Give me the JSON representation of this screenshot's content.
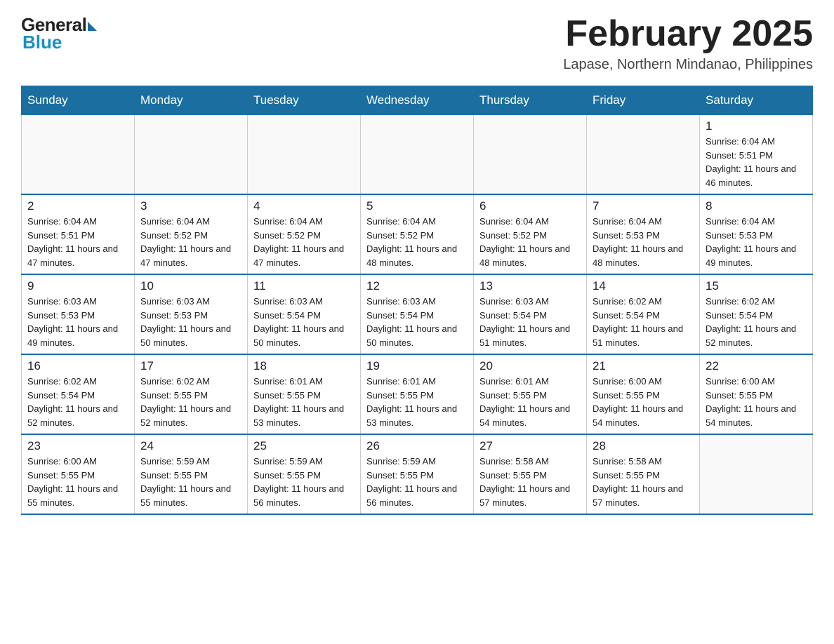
{
  "header": {
    "logo_general": "General",
    "logo_blue": "Blue",
    "month_title": "February 2025",
    "location": "Lapase, Northern Mindanao, Philippines"
  },
  "weekdays": [
    "Sunday",
    "Monday",
    "Tuesday",
    "Wednesday",
    "Thursday",
    "Friday",
    "Saturday"
  ],
  "weeks": [
    [
      {
        "day": "",
        "info": ""
      },
      {
        "day": "",
        "info": ""
      },
      {
        "day": "",
        "info": ""
      },
      {
        "day": "",
        "info": ""
      },
      {
        "day": "",
        "info": ""
      },
      {
        "day": "",
        "info": ""
      },
      {
        "day": "1",
        "info": "Sunrise: 6:04 AM\nSunset: 5:51 PM\nDaylight: 11 hours and 46 minutes."
      }
    ],
    [
      {
        "day": "2",
        "info": "Sunrise: 6:04 AM\nSunset: 5:51 PM\nDaylight: 11 hours and 47 minutes."
      },
      {
        "day": "3",
        "info": "Sunrise: 6:04 AM\nSunset: 5:52 PM\nDaylight: 11 hours and 47 minutes."
      },
      {
        "day": "4",
        "info": "Sunrise: 6:04 AM\nSunset: 5:52 PM\nDaylight: 11 hours and 47 minutes."
      },
      {
        "day": "5",
        "info": "Sunrise: 6:04 AM\nSunset: 5:52 PM\nDaylight: 11 hours and 48 minutes."
      },
      {
        "day": "6",
        "info": "Sunrise: 6:04 AM\nSunset: 5:52 PM\nDaylight: 11 hours and 48 minutes."
      },
      {
        "day": "7",
        "info": "Sunrise: 6:04 AM\nSunset: 5:53 PM\nDaylight: 11 hours and 48 minutes."
      },
      {
        "day": "8",
        "info": "Sunrise: 6:04 AM\nSunset: 5:53 PM\nDaylight: 11 hours and 49 minutes."
      }
    ],
    [
      {
        "day": "9",
        "info": "Sunrise: 6:03 AM\nSunset: 5:53 PM\nDaylight: 11 hours and 49 minutes."
      },
      {
        "day": "10",
        "info": "Sunrise: 6:03 AM\nSunset: 5:53 PM\nDaylight: 11 hours and 50 minutes."
      },
      {
        "day": "11",
        "info": "Sunrise: 6:03 AM\nSunset: 5:54 PM\nDaylight: 11 hours and 50 minutes."
      },
      {
        "day": "12",
        "info": "Sunrise: 6:03 AM\nSunset: 5:54 PM\nDaylight: 11 hours and 50 minutes."
      },
      {
        "day": "13",
        "info": "Sunrise: 6:03 AM\nSunset: 5:54 PM\nDaylight: 11 hours and 51 minutes."
      },
      {
        "day": "14",
        "info": "Sunrise: 6:02 AM\nSunset: 5:54 PM\nDaylight: 11 hours and 51 minutes."
      },
      {
        "day": "15",
        "info": "Sunrise: 6:02 AM\nSunset: 5:54 PM\nDaylight: 11 hours and 52 minutes."
      }
    ],
    [
      {
        "day": "16",
        "info": "Sunrise: 6:02 AM\nSunset: 5:54 PM\nDaylight: 11 hours and 52 minutes."
      },
      {
        "day": "17",
        "info": "Sunrise: 6:02 AM\nSunset: 5:55 PM\nDaylight: 11 hours and 52 minutes."
      },
      {
        "day": "18",
        "info": "Sunrise: 6:01 AM\nSunset: 5:55 PM\nDaylight: 11 hours and 53 minutes."
      },
      {
        "day": "19",
        "info": "Sunrise: 6:01 AM\nSunset: 5:55 PM\nDaylight: 11 hours and 53 minutes."
      },
      {
        "day": "20",
        "info": "Sunrise: 6:01 AM\nSunset: 5:55 PM\nDaylight: 11 hours and 54 minutes."
      },
      {
        "day": "21",
        "info": "Sunrise: 6:00 AM\nSunset: 5:55 PM\nDaylight: 11 hours and 54 minutes."
      },
      {
        "day": "22",
        "info": "Sunrise: 6:00 AM\nSunset: 5:55 PM\nDaylight: 11 hours and 54 minutes."
      }
    ],
    [
      {
        "day": "23",
        "info": "Sunrise: 6:00 AM\nSunset: 5:55 PM\nDaylight: 11 hours and 55 minutes."
      },
      {
        "day": "24",
        "info": "Sunrise: 5:59 AM\nSunset: 5:55 PM\nDaylight: 11 hours and 55 minutes."
      },
      {
        "day": "25",
        "info": "Sunrise: 5:59 AM\nSunset: 5:55 PM\nDaylight: 11 hours and 56 minutes."
      },
      {
        "day": "26",
        "info": "Sunrise: 5:59 AM\nSunset: 5:55 PM\nDaylight: 11 hours and 56 minutes."
      },
      {
        "day": "27",
        "info": "Sunrise: 5:58 AM\nSunset: 5:55 PM\nDaylight: 11 hours and 57 minutes."
      },
      {
        "day": "28",
        "info": "Sunrise: 5:58 AM\nSunset: 5:55 PM\nDaylight: 11 hours and 57 minutes."
      },
      {
        "day": "",
        "info": ""
      }
    ]
  ]
}
